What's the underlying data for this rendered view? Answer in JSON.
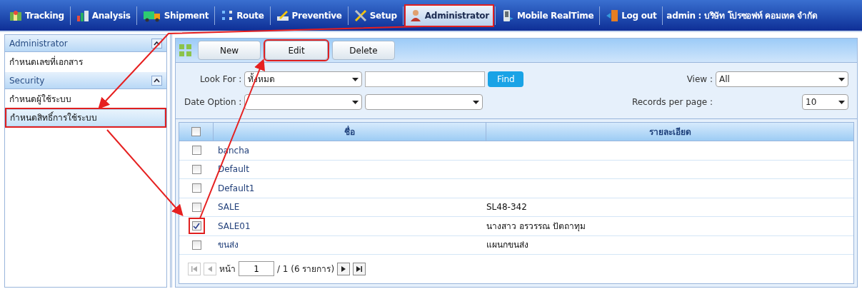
{
  "nav": {
    "items": [
      {
        "label": "Tracking",
        "selected": false,
        "annotated": false
      },
      {
        "label": "Analysis",
        "selected": false,
        "annotated": false
      },
      {
        "label": "Shipment",
        "selected": false,
        "annotated": false
      },
      {
        "label": "Route",
        "selected": false,
        "annotated": false
      },
      {
        "label": "Preventive",
        "selected": false,
        "annotated": false
      },
      {
        "label": "Setup",
        "selected": false,
        "annotated": false
      },
      {
        "label": "Administrator",
        "selected": true,
        "annotated": true
      },
      {
        "label": "Mobile RealTime",
        "selected": false,
        "annotated": false
      },
      {
        "label": "Log out",
        "selected": false,
        "annotated": false
      }
    ],
    "user": "admin : บริษัท โปรซอฟท์ คอมเทค จำกัด"
  },
  "sidebar": {
    "sections": [
      {
        "title": "Administrator",
        "expanded": true,
        "items": [
          {
            "label": "กำหนดเลขที่เอกสาร",
            "selected": false,
            "annotated": false
          }
        ]
      },
      {
        "title": "Security",
        "expanded": true,
        "items": [
          {
            "label": "กำหนดผู้ใช้ระบบ",
            "selected": false,
            "annotated": false
          },
          {
            "label": "กำหนดสิทธิ์การใช้ระบบ",
            "selected": true,
            "annotated": true
          }
        ]
      }
    ]
  },
  "toolbar": {
    "buttons": [
      {
        "label": "New",
        "annotated": false
      },
      {
        "label": "Edit",
        "annotated": true
      },
      {
        "label": "Delete",
        "annotated": false
      }
    ]
  },
  "filters": {
    "look_for_label": "Look For :",
    "look_for_value": "ทั้งหมด",
    "find": "Find",
    "view_label": "View :",
    "view_value": "All",
    "date_option_label": "Date Option :",
    "records_label": "Records per page :",
    "records_value": "10"
  },
  "table": {
    "columns": [
      "ชื่อ",
      "รายละเอียด"
    ],
    "header_checked": false,
    "rows": [
      {
        "name": "bancha",
        "detail": "",
        "checked": false,
        "annotated": false
      },
      {
        "name": "Default",
        "detail": "",
        "checked": false,
        "annotated": false
      },
      {
        "name": "Default1",
        "detail": "",
        "checked": false,
        "annotated": false
      },
      {
        "name": "SALE",
        "detail": "SL48-342",
        "checked": false,
        "annotated": false
      },
      {
        "name": "SALE01",
        "detail": "นางสาว อรวรรณ ปัตถาทุม",
        "checked": true,
        "annotated": true
      },
      {
        "name": "ขนส่ง",
        "detail": "แผนกขนส่ง",
        "checked": false,
        "annotated": false
      }
    ]
  },
  "pager": {
    "page_label": "หน้า",
    "page": "1",
    "total": "/ 1 (6 รายการ)"
  }
}
